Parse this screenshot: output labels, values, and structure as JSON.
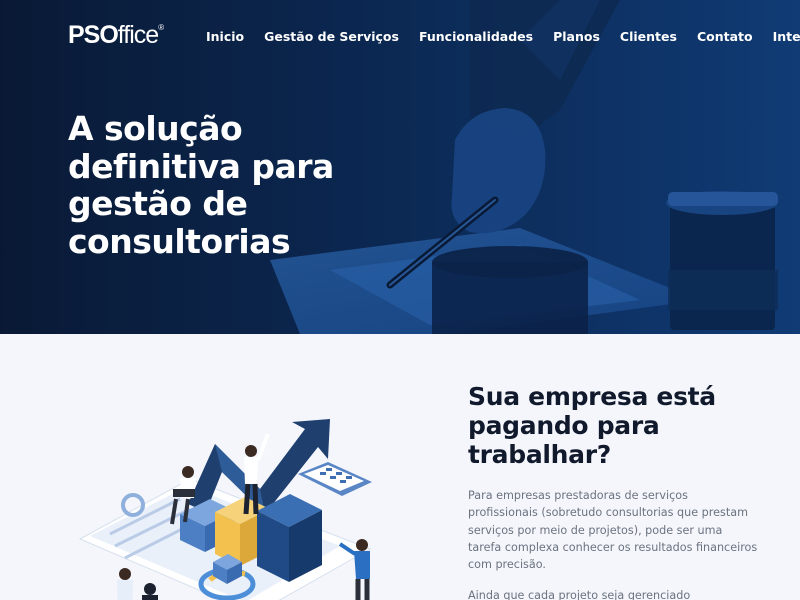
{
  "brand": {
    "logo_bold": "PSO",
    "logo_rest": "ffice",
    "logo_mark": "®"
  },
  "nav": {
    "items": [
      {
        "label": "Inicio"
      },
      {
        "label": "Gestão de Serviços"
      },
      {
        "label": "Funcionalidades"
      },
      {
        "label": "Planos"
      },
      {
        "label": "Clientes"
      },
      {
        "label": "Contato"
      },
      {
        "label": "Integrações"
      }
    ]
  },
  "hero": {
    "title_parts": [
      "A ",
      "solução",
      " ",
      "definitiva",
      " para ",
      "gestão de",
      " ",
      "consultorias"
    ]
  },
  "intro": {
    "heading_bold": "Sua empresa está pagando para",
    "heading_rest": "trabalhar?",
    "paragraph_1": "Para empresas prestadoras de serviços profissionais (sobretudo consultorias que prestam serviços por meio de projetos), pode ser uma tarefa complexa conhecer os resultados financeiros com precisão.",
    "paragraph_2": "Ainda que cada projeto seja gerenciado"
  },
  "colors": {
    "hero_dark": "#0b1f3f",
    "hero_blue": "#103a78",
    "accent_blue": "#1d5fae",
    "illustration_navy": "#1f3f6e",
    "illustration_yellow": "#f2c14e",
    "page_background": "#f4f6fb"
  }
}
